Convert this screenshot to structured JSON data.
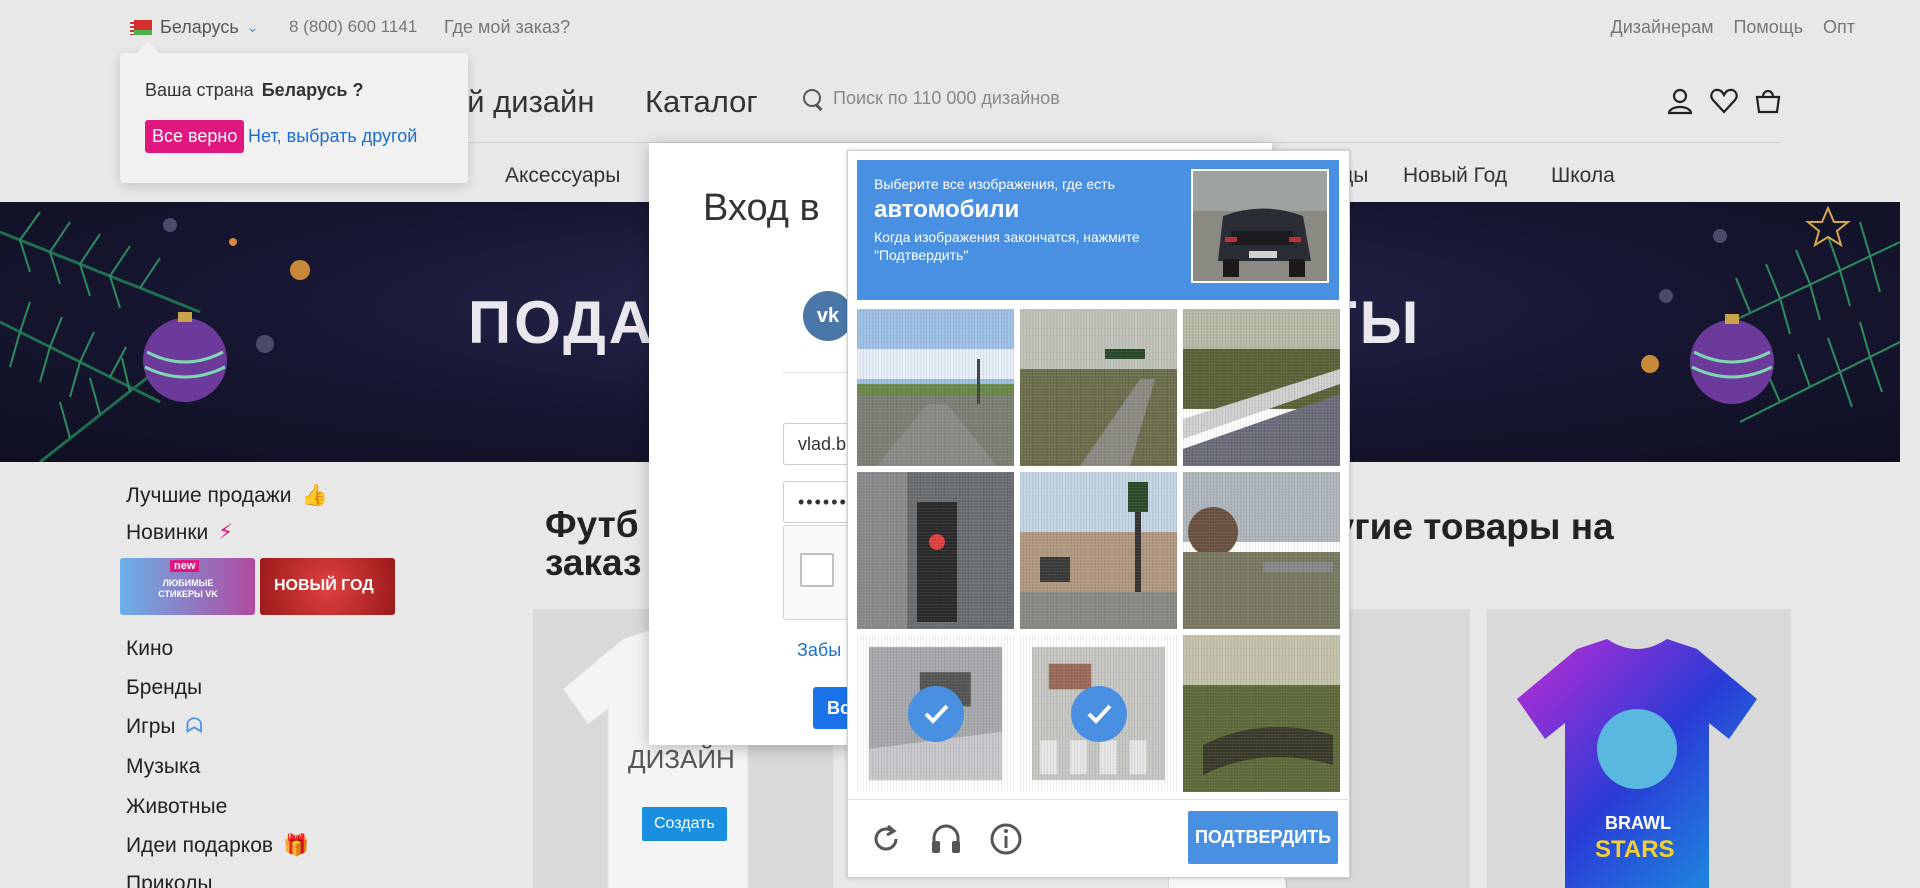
{
  "topbar": {
    "country": "Беларусь",
    "phone": "8 (800) 600 1141",
    "order": "Где мой заказ?",
    "links": [
      "Дизайнерам",
      "Помощь",
      "Опт"
    ]
  },
  "header": {
    "title_partial": "ой дизайн",
    "catalog": "Каталог",
    "search_placeholder": "Поиск по 110 000 дизайнов"
  },
  "nav": {
    "items": [
      "Аксессуары",
      "ды",
      "Новый Год",
      "Школа"
    ]
  },
  "country_popover": {
    "question": "Ваша страна",
    "country": "Беларусь ?",
    "confirm": "Все верно",
    "other": "Нет, выбрать другой"
  },
  "banner": {
    "text_left": "ПОДА",
    "text_right": "ТЫ"
  },
  "sidebar": {
    "best": "Лучшие продажи",
    "new": "Новинки",
    "tile1_badge": "new",
    "tile1_text": "ЛЮБИМЫЕ СТИКЕРЫ VK",
    "tile2_text": "НОВЫЙ ГОД",
    "items": [
      "Кино",
      "Бренды",
      "Игры",
      "Музыка",
      "Животные",
      "Идеи подарков",
      "Приколы"
    ]
  },
  "main": {
    "title_part1": "Футб",
    "title_part1b": "заказ",
    "title_part2": "и другие товары на",
    "card1_text": "ДИЗАЙН",
    "card1_button": "Создать"
  },
  "login": {
    "title": "Вход в",
    "vk": "vk",
    "email": "vlad.b",
    "password_mask": "••••••",
    "forgot": "Забы",
    "submit": "Во"
  },
  "captcha": {
    "line1": "Выберите все изображения, где есть",
    "target": "автомобили",
    "line3": "Когда изображения закончатся, нажмите \"Подтвердить\"",
    "verify": "ПОДТВЕРДИТЬ",
    "selected_cells": [
      6,
      7
    ]
  },
  "colors": {
    "accent_pink": "#e0177f",
    "captcha_blue": "#4a90e2",
    "link_blue": "#1a6fd0"
  }
}
